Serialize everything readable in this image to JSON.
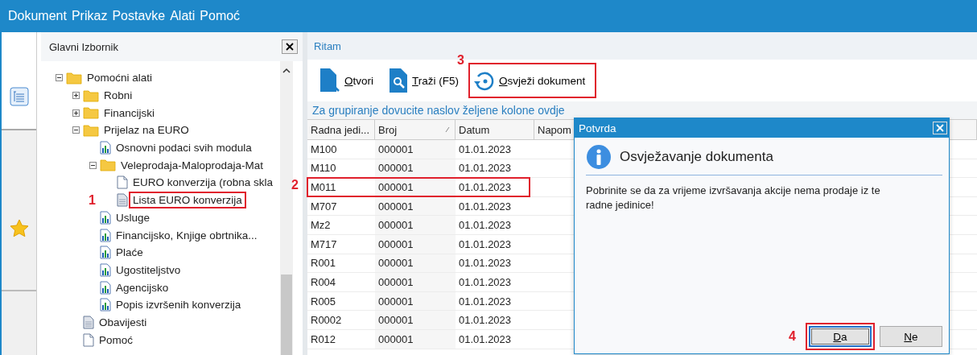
{
  "menu": [
    "Dokument",
    "Prikaz",
    "Postavke",
    "Alati",
    "Pomoć"
  ],
  "main_menu": {
    "title": "Glavni Izbornik",
    "tree": [
      {
        "label": "Pomoćni alati",
        "kind": "folder",
        "expanded": true,
        "children": [
          {
            "label": "Robni",
            "kind": "folder",
            "expanded": false
          },
          {
            "label": "Financijski",
            "kind": "folder",
            "expanded": false
          },
          {
            "label": "Prijelaz na EURO",
            "kind": "folder",
            "expanded": true,
            "children": [
              {
                "label": "Osnovni podaci svih modula",
                "kind": "report"
              },
              {
                "label": "Veleprodaja-Maloprodaja-Mat",
                "kind": "folder",
                "expanded": true,
                "children": [
                  {
                    "label": "EURO konverzija (robna skla",
                    "kind": "document"
                  },
                  {
                    "label": "Lista EURO konverzija",
                    "kind": "list",
                    "highlighted": true,
                    "annotation": "1"
                  }
                ]
              },
              {
                "label": "Usluge",
                "kind": "report"
              },
              {
                "label": "Financijsko, Knjige obrtnika...",
                "kind": "report"
              },
              {
                "label": "Plaće",
                "kind": "report"
              },
              {
                "label": "Ugostiteljstvo",
                "kind": "report"
              },
              {
                "label": "Agencijsko",
                "kind": "report"
              },
              {
                "label": "Popis izvršenih konverzija",
                "kind": "report"
              }
            ]
          },
          {
            "label": "Obavijesti",
            "kind": "list"
          },
          {
            "label": "Pomoć",
            "kind": "document"
          }
        ]
      }
    ]
  },
  "document": {
    "title": "Ritam",
    "toolbar": [
      {
        "label": "Otvori",
        "kind": "open",
        "highlighted": false
      },
      {
        "label": "Traži (F5)",
        "kind": "search",
        "highlighted": false
      },
      {
        "label": "Osvježi dokument",
        "kind": "refresh",
        "highlighted": true,
        "annotation": "3"
      }
    ],
    "group_hint": "Za grupiranje dovucite naslov željene kolone ovdje",
    "columns": [
      {
        "label": "Radna jedi...",
        "sorted": false
      },
      {
        "label": "Broj",
        "sorted": true
      },
      {
        "label": "Datum",
        "sorted": false
      },
      {
        "label": "Napom",
        "sorted": false
      }
    ],
    "rows": [
      {
        "cells": [
          "M100",
          "000001",
          "01.01.2023"
        ],
        "highlighted": false
      },
      {
        "cells": [
          "M110",
          "000001",
          "01.01.2023"
        ],
        "highlighted": false
      },
      {
        "cells": [
          "M011",
          "000001",
          "01.01.2023"
        ],
        "highlighted": true,
        "annotation": "2"
      },
      {
        "cells": [
          "M707",
          "000001",
          "01.01.2023"
        ],
        "highlighted": false
      },
      {
        "cells": [
          "Mz2",
          "000001",
          "01.01.2023"
        ],
        "highlighted": false
      },
      {
        "cells": [
          "M717",
          "000001",
          "01.01.2023"
        ],
        "highlighted": false
      },
      {
        "cells": [
          "R001",
          "000001",
          "01.01.2023"
        ],
        "highlighted": false
      },
      {
        "cells": [
          "R004",
          "000001",
          "01.01.2023"
        ],
        "highlighted": false
      },
      {
        "cells": [
          "R005",
          "000001",
          "01.01.2023"
        ],
        "highlighted": false
      },
      {
        "cells": [
          "R0002",
          "000001",
          "01.01.2023"
        ],
        "highlighted": false
      },
      {
        "cells": [
          "R012",
          "000001",
          "01.01.2023"
        ],
        "highlighted": false
      }
    ]
  },
  "dialog": {
    "title": "Potvrda",
    "heading": "Osvježavanje dokumenta",
    "message": "Pobrinite se da za vrijeme izvršavanja akcije nema prodaje iz te radne jedinice!",
    "buttons": [
      {
        "label": "Da",
        "focused": true,
        "highlighted": true,
        "annotation": "4"
      },
      {
        "label": "Ne",
        "focused": false,
        "highlighted": false
      }
    ]
  }
}
